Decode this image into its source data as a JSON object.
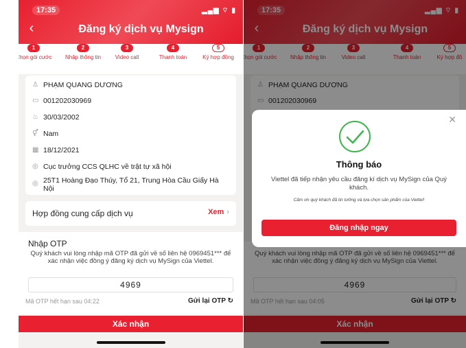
{
  "colors": {
    "brand": "#e8202f",
    "background": "#f3f2f1"
  },
  "left": {
    "status": {
      "time": "17:35",
      "icons": "▂▄▆ ⌔ ▮"
    },
    "header": {
      "title": "Đăng ký dịch vụ Mysign",
      "back": "‹"
    },
    "steps": [
      {
        "num": "1",
        "label": "Chọn gói cước"
      },
      {
        "num": "2",
        "label": "Nhập thông tin"
      },
      {
        "num": "3",
        "label": "Video call"
      },
      {
        "num": "4",
        "label": "Thanh toán"
      },
      {
        "num": "5",
        "label": "Ký hợp đồng"
      }
    ],
    "info": {
      "name": "PHẠM QUANG DƯƠNG",
      "id_number": "001202030969",
      "dob": "30/03/2002",
      "gender": "Nam",
      "issue_date": "18/12/2021",
      "issued_by": "Cục trưởng CCS QLHC về trật tự xã hội",
      "address": "25T1 Hoàng Đạo Thúy, Tổ 21, Trung Hòa Cầu Giấy Hà Nội"
    },
    "contract": {
      "label": "Hợp đồng cung cấp dịch vụ",
      "link": "Xem",
      "chevron": "›"
    },
    "otp": {
      "title": "Nhập OTP",
      "description": "Quý khách vui lòng nhập mã OTP đã gửi về số liên hệ 0969451*** để xác nhận việc đồng ý đăng ký dịch vụ MySign của Viettel.",
      "value": "4969",
      "expiry": "Mã OTP hết hạn sau 04:22",
      "resend": "Gửi lại OTP ↻"
    },
    "confirm": "Xác nhận"
  },
  "right": {
    "status": {
      "time": "17:35",
      "icons": "▂▄▆ ⌔ ▮"
    },
    "header": {
      "title": "Đăng ký dịch vụ Mysign",
      "back": "‹"
    },
    "steps": [
      {
        "num": "1",
        "label": "Chọn gói cước"
      },
      {
        "num": "2",
        "label": "Nhập thông tin"
      },
      {
        "num": "3",
        "label": "Video call"
      },
      {
        "num": "4",
        "label": "Thanh toán"
      },
      {
        "num": "5",
        "label": "Ký hợp đồ"
      }
    ],
    "info": {
      "name": "PHẠM QUANG DƯƠNG",
      "id_number": "001202030969"
    },
    "otp": {
      "description": "Quý khách vui lòng nhập mã OTP đã gửi về số liên hệ 0969451*** để xác nhận việc đồng ý đăng ký dịch vụ MySign của Viettel.",
      "value": "4969",
      "expiry": "Mã OTP hết hạn sau 04:05",
      "resend": "Gửi lại OTP ↻"
    },
    "confirm": "Xác nhận",
    "modal": {
      "close": "✕",
      "title": "Thông báo",
      "body": "Viettel đã tiếp nhận yêu cầu đăng kí dịch vụ MySign của Quý khách.",
      "thanks": "Cảm ơn quý khách đã tin tưởng và lựa chọn sản phẩm của Viettel!",
      "button": "Đăng nhập ngay"
    }
  }
}
